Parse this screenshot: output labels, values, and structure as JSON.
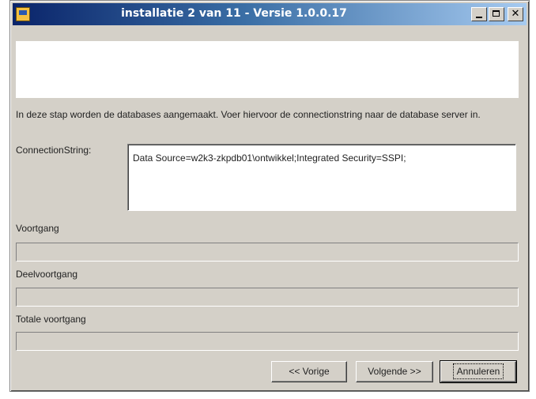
{
  "window": {
    "title": "installatie 2 van 11 - Versie 1.0.0.17",
    "close_symbol": "✕"
  },
  "intro": {
    "text": "In deze stap worden de databases aangemaakt. Voer hiervoor de connectionstring naar de database server in."
  },
  "connection": {
    "label": "ConnectionString:",
    "value": "Data Source=w2k3-zkpdb01\\ontwikkel;Integrated Security=SSPI;"
  },
  "progress": {
    "voortgang_label": "Voortgang",
    "voortgang_value": 0,
    "deelvoortgang_label": "Deelvoortgang",
    "deelvoortgang_value": 0,
    "totale_label": "Totale voortgang",
    "totale_value": 0
  },
  "buttons": {
    "previous": "<< Vorige",
    "next": "Volgende >>",
    "cancel": "Annuleren"
  },
  "icons": {
    "app": "installer-icon",
    "minimize": "minimize-icon",
    "maximize": "maximize-icon",
    "close": "close-icon"
  }
}
